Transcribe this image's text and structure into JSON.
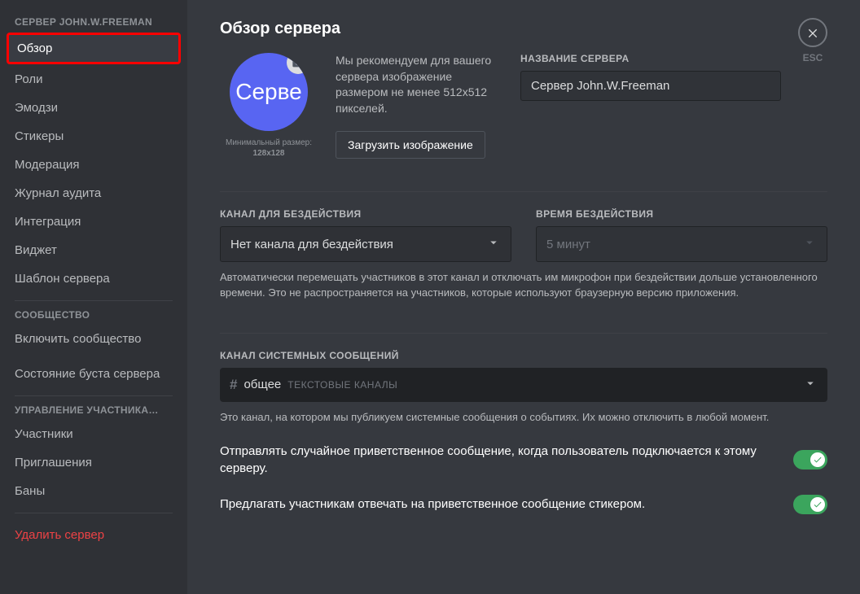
{
  "sidebar_header": "СЕРВЕР JOHN.W.FREEMAN",
  "sidebar": {
    "items": [
      "Обзор",
      "Роли",
      "Эмодзи",
      "Стикеры",
      "Модерация",
      "Журнал аудита",
      "Интеграция",
      "Виджет",
      "Шаблон сервера"
    ],
    "section2": "СООБЩЕСТВО",
    "items2": [
      "Включить сообщество",
      "Состояние буста сервера"
    ],
    "section3": "УПРАВЛЕНИЕ УЧАСТНИКА…",
    "items3": [
      "Участники",
      "Приглашения",
      "Баны"
    ],
    "delete": "Удалить сервер"
  },
  "close": {
    "esc": "ESC"
  },
  "page_title": "Обзор сервера",
  "icon": {
    "text": "Серве",
    "min_label": "Минимальный размер:",
    "min_value": "128x128",
    "recommend": "Мы рекомендуем для вашего сервера изображение размером не менее 512x512 пикселей.",
    "upload_btn": "Загрузить изображение"
  },
  "name": {
    "label": "НАЗВАНИЕ СЕРВЕРА",
    "value": "Сервер John.W.Freeman"
  },
  "afk": {
    "channel_label": "КАНАЛ ДЛЯ БЕЗДЕЙСТВИЯ",
    "channel_value": "Нет канала для бездействия",
    "timeout_label": "ВРЕМЯ БЕЗДЕЙСТВИЯ",
    "timeout_value": "5 минут",
    "help": "Автоматически перемещать участников в этот канал и отключать им микрофон при бездействии дольше установленного времени. Это не распространяется на участников, которые используют браузерную версию приложения."
  },
  "sys": {
    "label": "КАНАЛ СИСТЕМНЫХ СООБЩЕНИЙ",
    "channel": "общее",
    "category": "ТЕКСТОВЫЕ КАНАЛЫ",
    "help": "Это канал, на котором мы публикуем системные сообщения о событиях. Их можно отключить в любой момент.",
    "toggle1": "Отправлять случайное приветственное сообщение, когда пользователь подключается к этому серверу.",
    "toggle2": "Предлагать участникам отвечать на приветственное сообщение стикером."
  }
}
